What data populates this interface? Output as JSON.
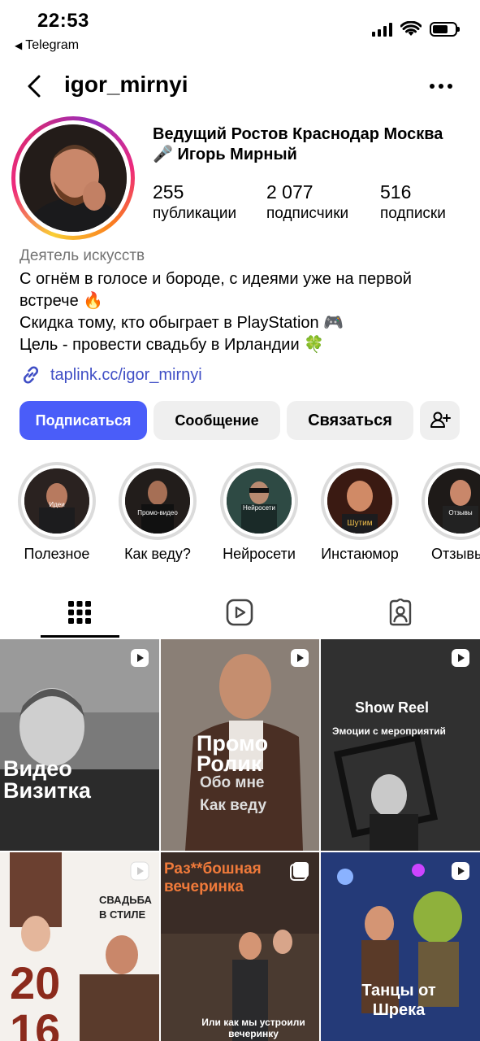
{
  "status_bar": {
    "time": "22:53",
    "back_app": "Telegram"
  },
  "header": {
    "username": "igor_mirnyi"
  },
  "profile": {
    "full_name": "Ведущий Ростов Краснодар Москва 🎤 Игорь Мирный",
    "stats": [
      {
        "value": "255",
        "label": "публикации"
      },
      {
        "value": "2 077",
        "label": "подписчики"
      },
      {
        "value": "516",
        "label": "подписки"
      }
    ],
    "category": "Деятель искусств",
    "bio_lines": [
      "С огнём в голосе и бороде, с идеями уже на первой встрече 🔥",
      "Скидка тому, кто обыграет в PlayStation 🎮",
      "Цель - провести свадьбу в Ирландии 🍀"
    ],
    "link": "taplink.cc/igor_mirnyi"
  },
  "buttons": {
    "subscribe": "Подписаться",
    "message": "Сообщение",
    "contact": "Связаться"
  },
  "highlights": [
    {
      "label": "Полезное",
      "cover_text": "Идеи"
    },
    {
      "label": "Как веду?",
      "cover_text": "Промо-видео"
    },
    {
      "label": "Нейросети",
      "cover_text": "Нейросети"
    },
    {
      "label": "Инстаюмор",
      "cover_text": "Шутим"
    },
    {
      "label": "Отзывы",
      "cover_text": "Отзывы"
    }
  ],
  "tabs": [
    "grid-icon",
    "reels-icon",
    "tagged-icon"
  ],
  "posts": [
    {
      "title": "Видео Визитка",
      "subtitle": ""
    },
    {
      "title": "Промо Ролик",
      "subtitle": "Обо мне",
      "subtitle2": "Как веду"
    },
    {
      "title": "Show Reel",
      "subtitle": "Эмоции с мероприятий"
    },
    {
      "title": "20 16",
      "subtitle": "СВАДЬБА В СТИЛЕ"
    },
    {
      "title": "Раз**бошная вечеринка",
      "subtitle": "Или как мы устроили вечеринку"
    },
    {
      "title": "Танцы от Шрека",
      "subtitle": ""
    }
  ],
  "colors": {
    "primary_button": "#4a5df9",
    "link": "#3f4ec5",
    "secondary_button": "#efefef",
    "muted_text": "#737373"
  }
}
